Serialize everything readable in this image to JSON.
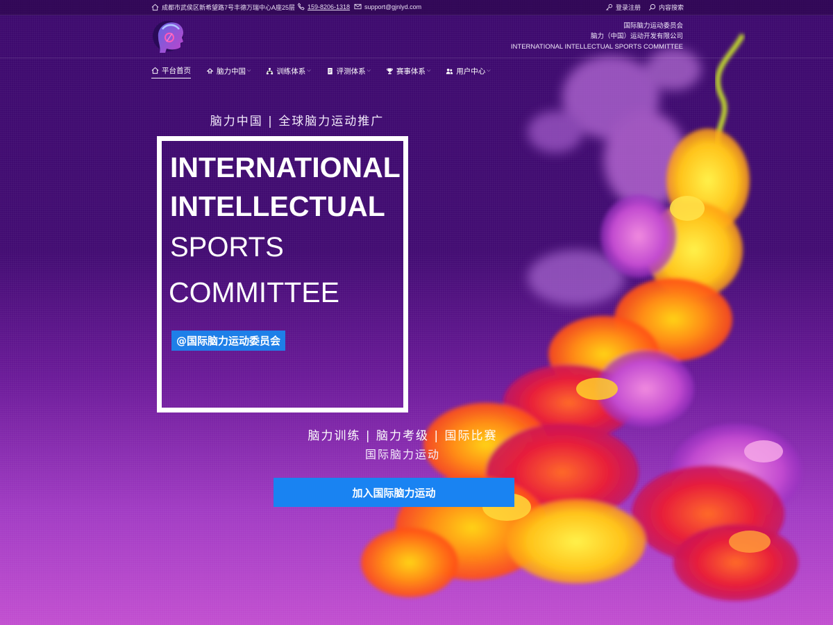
{
  "topbar": {
    "address": "成都市武侯区新希望路7号丰德万瑞中心A座25层",
    "phone": "159-8206-1318",
    "email": "support@gjnlyd.com",
    "login": "登录注册",
    "search": "内容搜索"
  },
  "header": {
    "org_line1": "国际脑力运动委员会",
    "org_line2": "脑力（中国）运动开发有限公司",
    "org_line3": "INTERNATIONAL INTELLECTUAL SPORTS COMMITTEE"
  },
  "nav": {
    "items": [
      {
        "label": "平台首页",
        "icon": "home-icon",
        "active": true
      },
      {
        "label": "脑力中国",
        "icon": "team-icon"
      },
      {
        "label": "训练体系",
        "icon": "sitemap-icon"
      },
      {
        "label": "评测体系",
        "icon": "document-icon"
      },
      {
        "label": "赛事体系",
        "icon": "trophy-icon"
      },
      {
        "label": "用户中心",
        "icon": "users-icon"
      }
    ]
  },
  "hero": {
    "tagline": "脑力中国 | 全球脑力运动推广",
    "title_line1": "INTERNATIONAL",
    "title_line2": "INTELLECTUAL",
    "title_line3": "SPORTS",
    "title_line4": "COMMITTEE",
    "badge": "@国际脑力运动委员会",
    "sub1": "脑力训练 | 脑力考级 | 国际比赛",
    "sub2": "国际脑力运动",
    "cta": "加入国际脑力运动"
  },
  "colors": {
    "accent_blue": "#1983f2",
    "badge_blue": "#1e7fe8",
    "bg_top": "#3d0a6e",
    "bg_bottom": "#c24fd0"
  }
}
